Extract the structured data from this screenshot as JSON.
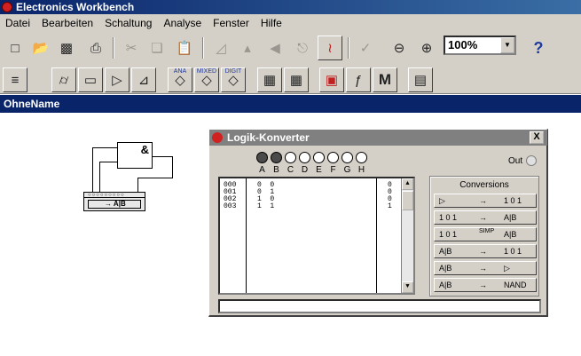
{
  "app": {
    "title": "Electronics Workbench"
  },
  "menu": [
    "Datei",
    "Bearbeiten",
    "Schaltung",
    "Analyse",
    "Fenster",
    "Hilfe"
  ],
  "toolbar": {
    "zoom_value": "100%",
    "help_label": "?",
    "meter_label": "M",
    "bin_ana": "ANA",
    "bin_mixed": "MIXED",
    "bin_digit": "DIGIT"
  },
  "document": {
    "title": "OhneName"
  },
  "circuit": {
    "gate_label": "&",
    "converter_label": "→ A|B"
  },
  "dialog": {
    "title": "Logik-Konverter",
    "close_label": "X",
    "inputs": [
      "A",
      "B",
      "C",
      "D",
      "E",
      "F",
      "G",
      "H"
    ],
    "out_label": "Out",
    "truth_table": {
      "index": [
        "000",
        "001",
        "002",
        "003"
      ],
      "inputs": [
        "0  0",
        "0  1",
        "1  0",
        "1  1"
      ],
      "outputs": [
        "0",
        "0",
        "0",
        "1"
      ]
    },
    "conversions_title": "Conversions",
    "conversions": [
      {
        "from": "▷",
        "arrow": "→",
        "to": "1 0 1"
      },
      {
        "from": "1 0 1",
        "arrow": "→",
        "to": "A|B"
      },
      {
        "from": "1 0 1",
        "arrow": "SIMP",
        "to": "A|B"
      },
      {
        "from": "A|B",
        "arrow": "→",
        "to": "1 0 1"
      },
      {
        "from": "A|B",
        "arrow": "→",
        "to": "▷"
      },
      {
        "from": "A|B",
        "arrow": "→",
        "to": "NAND"
      }
    ],
    "expression": ""
  }
}
